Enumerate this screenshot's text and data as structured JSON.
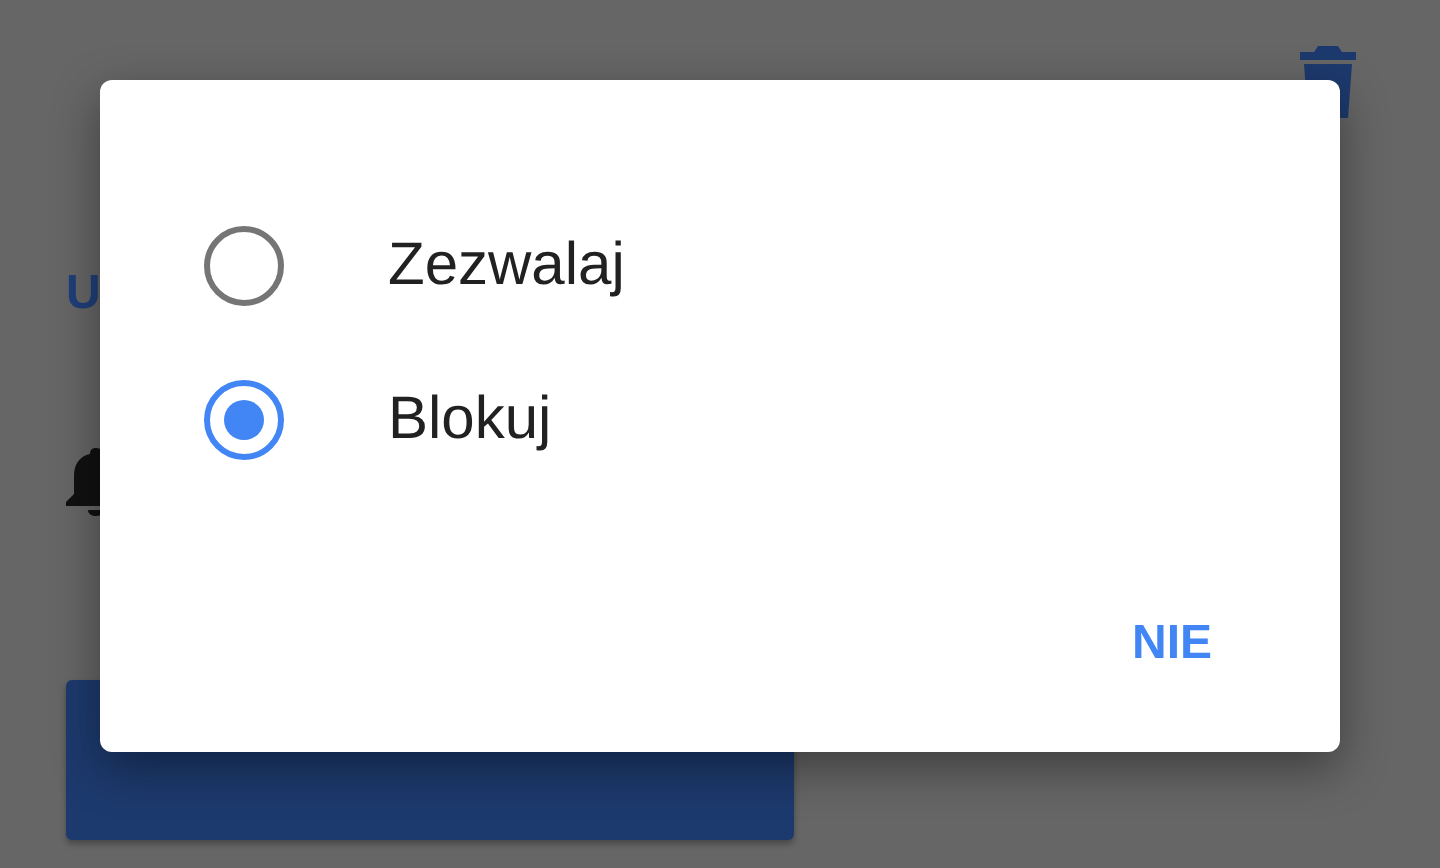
{
  "background": {
    "section_heading": "U"
  },
  "dialog": {
    "options": [
      {
        "label": "Zezwalaj",
        "selected": false
      },
      {
        "label": "Blokuj",
        "selected": true
      }
    ],
    "buttons": [
      "NIE"
    ]
  }
}
